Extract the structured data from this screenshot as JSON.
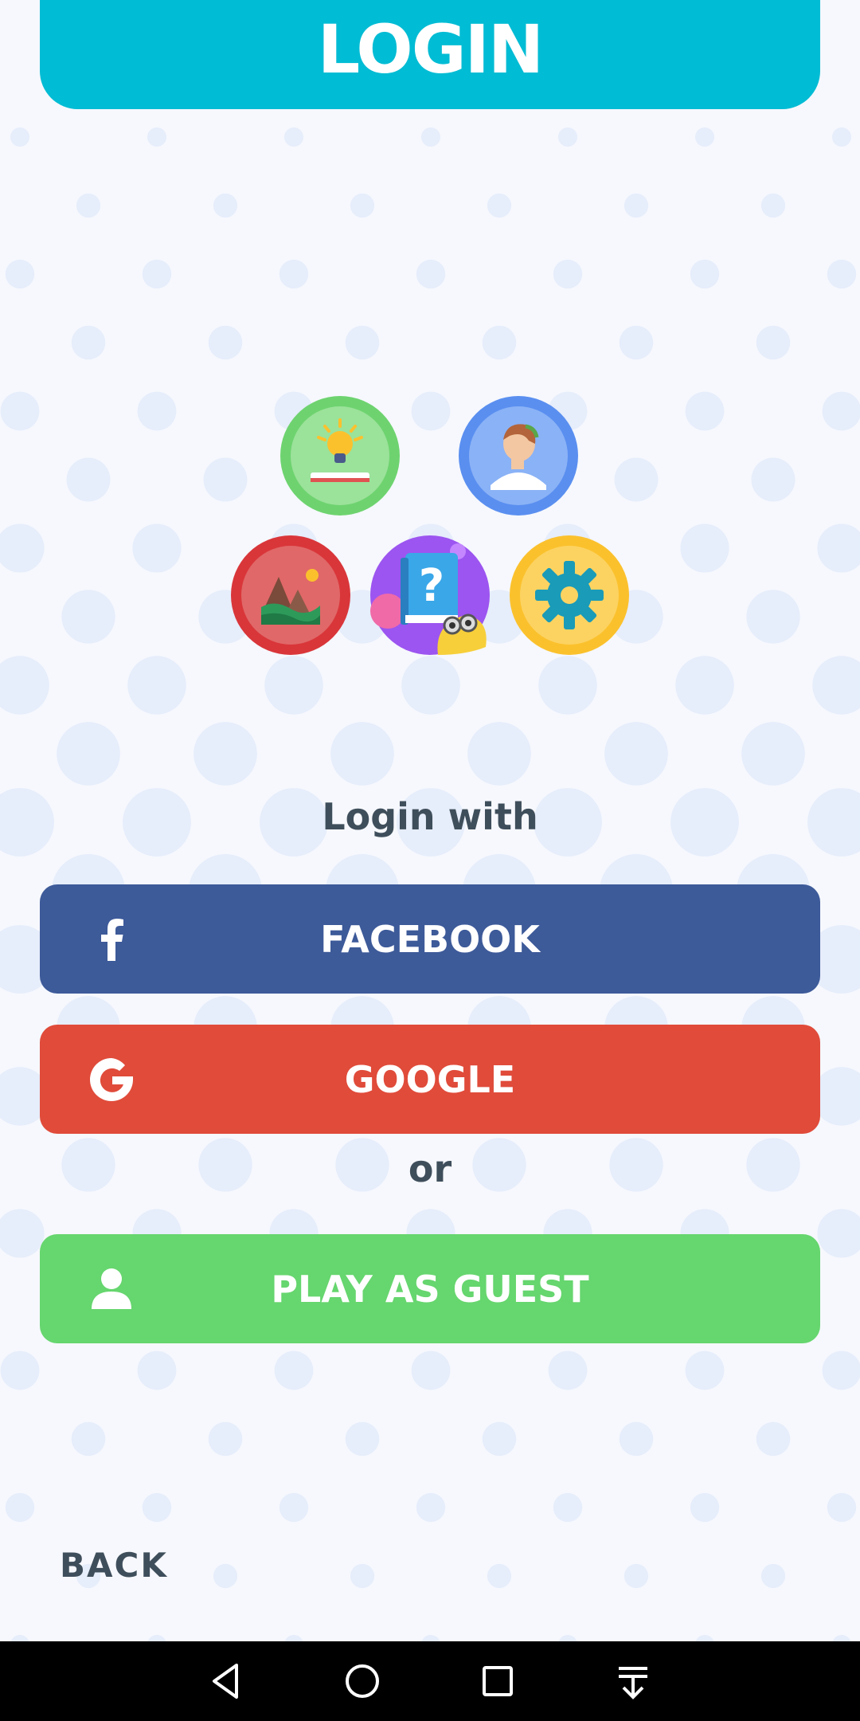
{
  "header": {
    "title": "LOGIN"
  },
  "badges": [
    {
      "icon": "lightbulb-book-icon",
      "color": "#6ed36f"
    },
    {
      "icon": "history-person-icon",
      "color": "#5a8ff0"
    },
    {
      "icon": "mountain-landscape-icon",
      "color": "#d9363a"
    },
    {
      "icon": "question-book-icon",
      "color": "#9c55f0"
    },
    {
      "icon": "gear-icon",
      "color": "#fbc12d"
    }
  ],
  "login_with_label": "Login with",
  "buttons": {
    "facebook": {
      "label": "FACEBOOK",
      "icon": "facebook-icon",
      "color": "#3d5a99"
    },
    "google": {
      "label": "GOOGLE",
      "icon": "google-icon",
      "color": "#e04b3a"
    },
    "guest": {
      "label": "PLAY AS GUEST",
      "icon": "person-icon",
      "color": "#66d66e"
    }
  },
  "or_label": "or",
  "back_label": "BACK",
  "navbar": {
    "items": [
      "back-triangle-icon",
      "home-circle-icon",
      "recents-square-icon",
      "notification-pull-icon"
    ]
  },
  "colors": {
    "accent": "#00bcd4",
    "background": "#f6f8fd",
    "text": "#3f4e5b"
  }
}
